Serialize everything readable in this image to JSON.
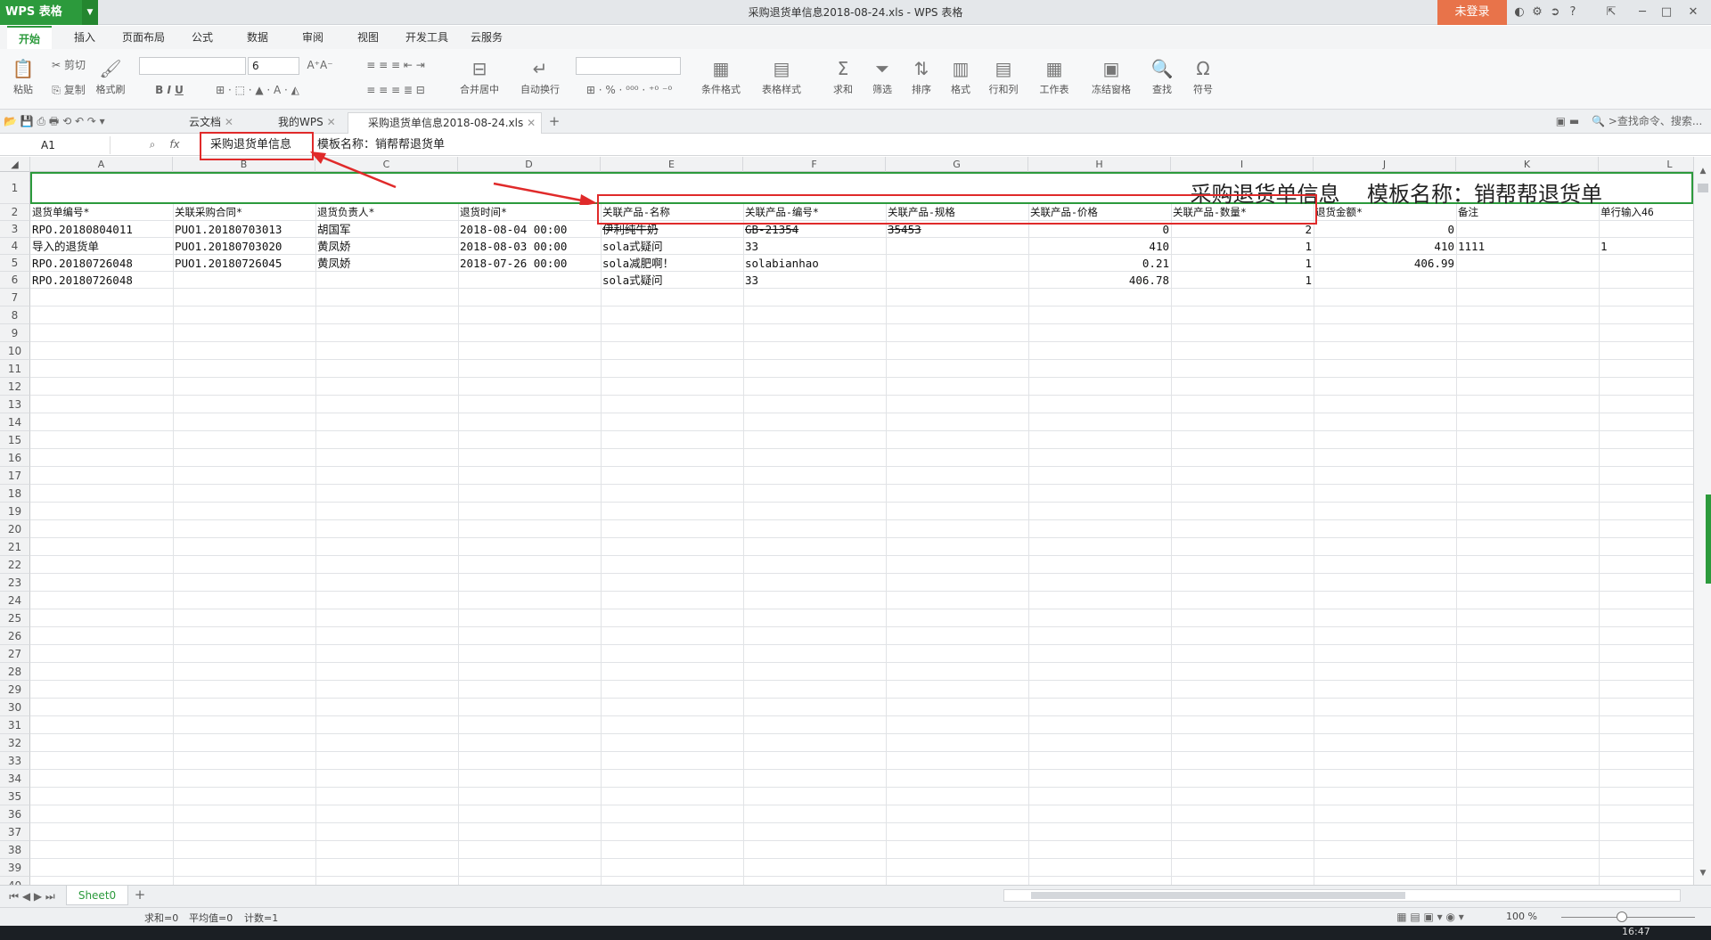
{
  "app": {
    "logo": "WPS 表格",
    "window_title": "采购退货单信息2018-08-24.xls - WPS 表格",
    "login": "未登录"
  },
  "menu": [
    "开始",
    "插入",
    "页面布局",
    "公式",
    "数据",
    "审阅",
    "视图",
    "开发工具",
    "云服务"
  ],
  "ribbon": {
    "paste": "粘贴",
    "cut": "剪切",
    "copy": "复制",
    "format_painter": "格式刷",
    "font_size": "6",
    "merge_center": "合并居中",
    "wrap": "自动换行",
    "cond_format": "条件格式",
    "table_style": "表格样式",
    "sum": "求和",
    "filter": "筛选",
    "sort": "排序",
    "format": "格式",
    "row_col": "行和列",
    "worksheet": "工作表",
    "freeze": "冻结窗格",
    "find": "查找",
    "symbol": "符号"
  },
  "tabs": {
    "cloud": "云文档",
    "mywps": "我的WPS",
    "file": "采购退货单信息2018-08-24.xls",
    "search": ">查找命令、搜索..."
  },
  "formula": {
    "cell_ref": "A1",
    "fx": "fx",
    "value_part1": "采购退货单信息",
    "value_part2": "模板名称：销帮帮退货单"
  },
  "columns": [
    "A",
    "B",
    "C",
    "D",
    "E",
    "F",
    "G",
    "H",
    "I",
    "J",
    "K",
    "L"
  ],
  "title_row": "采购退货单信息    模板名称：销帮帮退货单",
  "headers": [
    "退货单编号*",
    "关联采购合同*",
    "退货负责人*",
    "退货时间*",
    "关联产品-名称",
    "关联产品-编号*",
    "关联产品-规格",
    "关联产品-价格",
    "关联产品-数量*",
    "退货金额*",
    "备注",
    "单行输入46"
  ],
  "rows": [
    [
      "RPO.20180804011",
      "PUO1.20180703013",
      "胡国军",
      "2018-08-04 00:00",
      "伊利纯牛奶",
      "GB-21354",
      "35453",
      "0",
      "2",
      "0",
      "",
      ""
    ],
    [
      "导入的退货单",
      "PUO1.20180703020",
      "黄凤娇",
      "2018-08-03 00:00",
      "sola式疑问",
      "33",
      "",
      "410",
      "1",
      "410",
      "1111",
      "1"
    ],
    [
      "RPO.20180726048",
      "PUO1.20180726045",
      "黄凤娇",
      "2018-07-26 00:00",
      "sola减肥啊！",
      "solabianhao",
      "",
      "0.21",
      "1",
      "406.99",
      "",
      ""
    ],
    [
      "RPO.20180726048",
      "",
      "",
      "",
      "sola式疑问",
      "33",
      "",
      "406.78",
      "1",
      "",
      "",
      ""
    ]
  ],
  "sheet_tab": "Sheet0",
  "status": {
    "sum": "求和=0",
    "avg": "平均值=0",
    "count": "计数=1",
    "zoom": "100 %"
  },
  "taskbar_time": "16:47",
  "colors": {
    "brand": "#2c9a3c",
    "login": "#e8734a",
    "annotation": "#e02a2a"
  }
}
